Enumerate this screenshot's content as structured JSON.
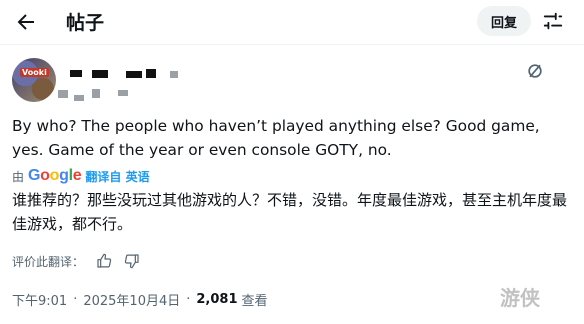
{
  "header": {
    "title": "帖子",
    "reply_label": "回复"
  },
  "tweet": {
    "avatar_text": "Vooki",
    "text": "By who? The people who haven’t played anything else? Good game, yes. Game of the year or even console GOTY, no.",
    "translated_by_prefix": "由",
    "translator": "Google",
    "translate_link": "翻译自 英语",
    "translated_text": "谁推荐的？那些没玩过其他游戏的人？不错，没错。年度最佳游戏，甚至主机年度最佳游戏，都不行。",
    "rate_label": "评价此翻译：",
    "time": "下午9:01",
    "date": "2025年10月4日",
    "separator": "·",
    "views_count": "2,081",
    "views_label": "查看"
  },
  "watermark": "游侠"
}
